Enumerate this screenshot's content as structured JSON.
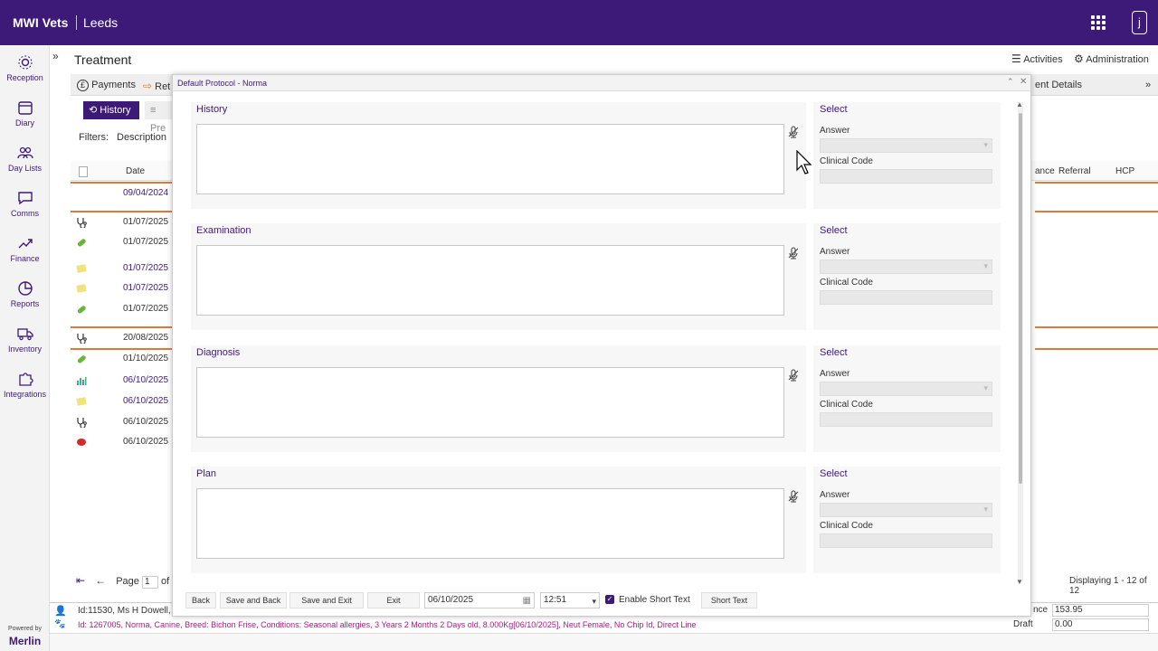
{
  "topbar": {
    "brand": "MWI Vets",
    "site": "Leeds",
    "user_initial": "j"
  },
  "sidebar": {
    "items": [
      {
        "label": "Reception",
        "icon": "reception-icon"
      },
      {
        "label": "Diary",
        "icon": "calendar-icon"
      },
      {
        "label": "Day Lists",
        "icon": "people-icon"
      },
      {
        "label": "Comms",
        "icon": "chat-icon"
      },
      {
        "label": "Finance",
        "icon": "trend-icon"
      },
      {
        "label": "Reports",
        "icon": "pie-chart-icon"
      },
      {
        "label": "Inventory",
        "icon": "truck-icon"
      },
      {
        "label": "Integrations",
        "icon": "puzzle-icon"
      }
    ],
    "powered_by": "Powered by",
    "merlin": "Merlin"
  },
  "page": {
    "title": "Treatment",
    "activities": "Activities",
    "administration": "Administration"
  },
  "tabs": {
    "payments": "Payments",
    "ret": "Ret",
    "ent_details": "ent Details",
    "history": "History",
    "pre": "Pre"
  },
  "filters": {
    "label": "Filters:",
    "description": "Description"
  },
  "table": {
    "headers": {
      "date": "Date",
      "ance": "ance",
      "referral": "Referral",
      "hcp": "HCP"
    },
    "rows": [
      {
        "date": "09/04/2024",
        "icon": "blank",
        "color": "#3d1a78"
      },
      {
        "date": "01/07/2025",
        "icon": "stethoscope",
        "color": "#333333"
      },
      {
        "date": "01/07/2025",
        "icon": "pill",
        "color": "#333333"
      },
      {
        "date": "01/07/2025",
        "icon": "note",
        "color": "#3d1a78"
      },
      {
        "date": "01/07/2025",
        "icon": "note",
        "color": "#3d1a78"
      },
      {
        "date": "01/07/2025",
        "icon": "pill",
        "color": "#333333"
      },
      {
        "date": "20/08/2025",
        "icon": "stethoscope",
        "color": "#333333"
      },
      {
        "date": "01/10/2025",
        "icon": "pill",
        "color": "#333333"
      },
      {
        "date": "06/10/2025",
        "icon": "chart",
        "color": "#3d1a78"
      },
      {
        "date": "06/10/2025",
        "icon": "note",
        "color": "#3d1a78"
      },
      {
        "date": "06/10/2025",
        "icon": "stethoscope",
        "color": "#333333"
      },
      {
        "date": "06/10/2025",
        "icon": "red",
        "color": "#333333"
      }
    ]
  },
  "pager": {
    "page_label": "Page",
    "page_value": "1",
    "of_label": "of",
    "displaying": "Displaying 1 - 12 of 12"
  },
  "bottom": {
    "client": "Id:11530, Ms H Dowell, 12",
    "patient": "Id: 1267005, Norma, Canine, Breed: Bichon Frise, Conditions: Seasonal allergies, 3 Years 2 Months 2 Days old, 8.000Kg[06/10/2025], Neut Female, No Chip Id, Direct Line",
    "balance_label": "nce",
    "balance_value": "153.95",
    "draft_label": "Draft",
    "draft_value": "0.00"
  },
  "modal": {
    "title": "Default Protocol - Norma",
    "sections": [
      {
        "label": "History",
        "value": ""
      },
      {
        "label": "Examination",
        "value": ""
      },
      {
        "label": "Diagnosis",
        "value": ""
      },
      {
        "label": "Plan",
        "value": ""
      }
    ],
    "side_select": "Select",
    "side_answer": "Answer",
    "side_clinical": "Clinical Code",
    "buttons": {
      "back": "Back",
      "save_back": "Save and Back",
      "save_exit": "Save and Exit",
      "exit": "Exit",
      "short_text": "Short Text"
    },
    "date": "06/10/2025",
    "time": "12:51",
    "enable_short_text": "Enable Short Text",
    "enable_short_text_checked": true
  },
  "colors": {
    "brand": "#3d1a78",
    "accent_line": "#e07a3a",
    "patient_text": "#b0168c"
  }
}
